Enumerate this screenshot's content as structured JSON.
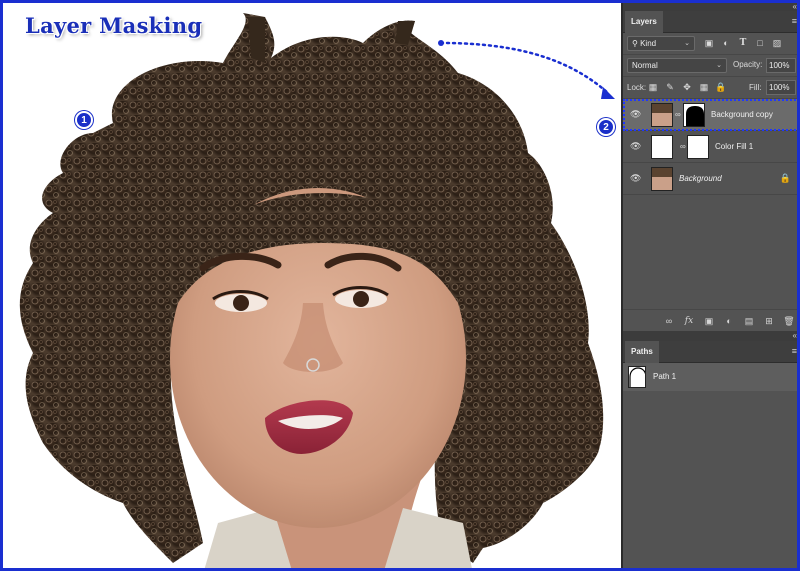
{
  "tutorial": {
    "title": "Layer Masking",
    "step_1": "1",
    "step_2": "2"
  },
  "colors": {
    "accent": "#1a2fd0",
    "panel_bg": "#535353",
    "selection_outline": "#1f37ff"
  },
  "layers_panel": {
    "tab_label": "Layers",
    "filter_kind": "Kind",
    "blend_mode": "Normal",
    "opacity_label": "Opacity:",
    "opacity_value": "100%",
    "lock_label": "Lock:",
    "fill_label": "Fill:",
    "fill_value": "100%",
    "filter_icons": [
      "image-filter-icon",
      "adjustment-filter-icon",
      "type-filter-icon",
      "shape-filter-icon",
      "smart-object-filter-icon"
    ],
    "lock_icons": [
      "lock-pixels-icon",
      "lock-paint-icon",
      "lock-position-icon",
      "lock-artboard-icon",
      "lock-all-icon"
    ],
    "layers": [
      {
        "name": "Background copy",
        "selected": true,
        "visible": true
      },
      {
        "name": "Color Fill 1",
        "selected": false,
        "visible": true
      },
      {
        "name": "Background",
        "selected": false,
        "visible": true,
        "locked": true
      }
    ],
    "bottom_icons": [
      "link-layers-icon",
      "fx-icon",
      "add-mask-icon",
      "adjustment-layer-icon",
      "new-group-icon",
      "new-layer-icon",
      "delete-icon"
    ]
  },
  "paths_panel": {
    "tab_label": "Paths",
    "paths": [
      {
        "name": "Path 1"
      }
    ]
  }
}
